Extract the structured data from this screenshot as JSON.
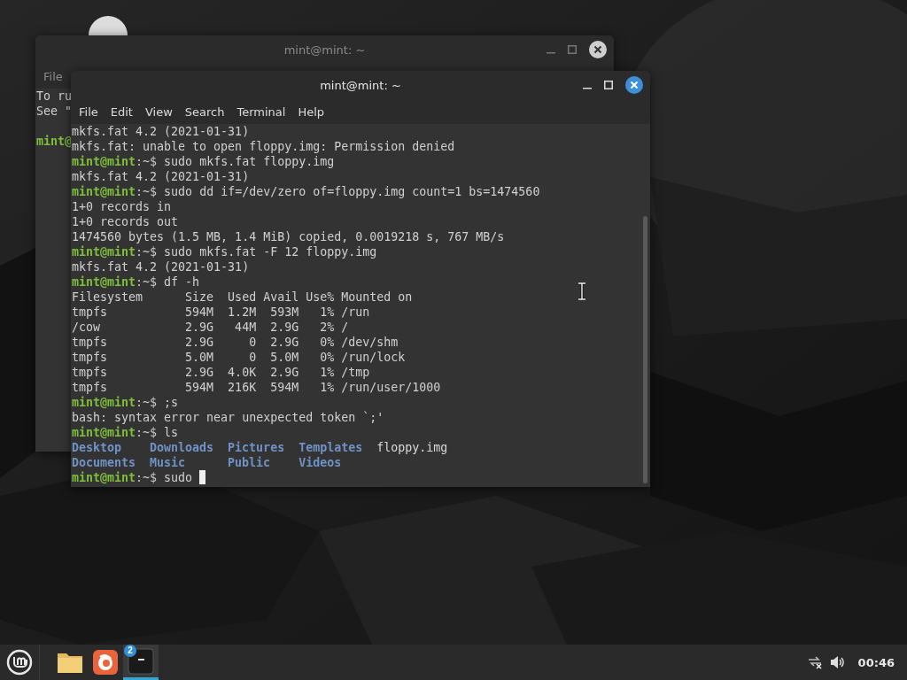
{
  "back_window": {
    "title": "mint@mint: ~",
    "focused": false,
    "menu": [
      "File"
    ],
    "lines": [
      {
        "kind": "output",
        "text": "To ru"
      },
      {
        "kind": "output",
        "text": "See \""
      },
      {
        "kind": "blank"
      },
      {
        "kind": "prompt",
        "host": "mint@"
      }
    ]
  },
  "front_window": {
    "title": "mint@mint: ~",
    "focused": true,
    "menu": [
      "File",
      "Edit",
      "View",
      "Search",
      "Terminal",
      "Help"
    ],
    "lines": [
      {
        "kind": "output",
        "text": "mkfs.fat 4.2 (2021-01-31)"
      },
      {
        "kind": "output",
        "text": "mkfs.fat: unable to open floppy.img: Permission denied"
      },
      {
        "kind": "prompt",
        "host": "mint@mint",
        "path": ":~$",
        "command": "sudo mkfs.fat floppy.img"
      },
      {
        "kind": "output",
        "text": "mkfs.fat 4.2 (2021-01-31)"
      },
      {
        "kind": "prompt",
        "host": "mint@mint",
        "path": ":~$",
        "command": "sudo dd if=/dev/zero of=floppy.img count=1 bs=1474560"
      },
      {
        "kind": "output",
        "text": "1+0 records in"
      },
      {
        "kind": "output",
        "text": "1+0 records out"
      },
      {
        "kind": "output",
        "text": "1474560 bytes (1.5 MB, 1.4 MiB) copied, 0.0019218 s, 767 MB/s"
      },
      {
        "kind": "prompt",
        "host": "mint@mint",
        "path": ":~$",
        "command": "sudo mkfs.fat -F 12 floppy.img"
      },
      {
        "kind": "output",
        "text": "mkfs.fat 4.2 (2021-01-31)"
      },
      {
        "kind": "prompt",
        "host": "mint@mint",
        "path": ":~$",
        "command": "df -h"
      },
      {
        "kind": "output",
        "text": "Filesystem      Size  Used Avail Use% Mounted on"
      },
      {
        "kind": "output",
        "text": "tmpfs           594M  1.2M  593M   1% /run"
      },
      {
        "kind": "output",
        "text": "/cow            2.9G   44M  2.9G   2% /"
      },
      {
        "kind": "output",
        "text": "tmpfs           2.9G     0  2.9G   0% /dev/shm"
      },
      {
        "kind": "output",
        "text": "tmpfs           5.0M     0  5.0M   0% /run/lock"
      },
      {
        "kind": "output",
        "text": "tmpfs           2.9G  4.0K  2.9G   1% /tmp"
      },
      {
        "kind": "output",
        "text": "tmpfs           594M  216K  594M   1% /run/user/1000"
      },
      {
        "kind": "prompt",
        "host": "mint@mint",
        "path": ":~$",
        "command": ";s"
      },
      {
        "kind": "output",
        "text": "bash: syntax error near unexpected token `;'"
      },
      {
        "kind": "prompt",
        "host": "mint@mint",
        "path": ":~$",
        "command": "ls"
      },
      {
        "kind": "listing",
        "entries": [
          {
            "text": "Desktop",
            "kind": "dir"
          },
          {
            "text": "Downloads",
            "kind": "dir"
          },
          {
            "text": "Pictures",
            "kind": "dir"
          },
          {
            "text": "Templates",
            "kind": "dir"
          },
          {
            "text": "floppy.img",
            "kind": "file"
          }
        ]
      },
      {
        "kind": "listing",
        "entries": [
          {
            "text": "Documents",
            "kind": "dir"
          },
          {
            "text": "Music",
            "kind": "dir"
          },
          {
            "text": "Public",
            "kind": "dir"
          },
          {
            "text": "Videos",
            "kind": "dir"
          }
        ]
      },
      {
        "kind": "prompt",
        "host": "mint@mint",
        "path": ":~$",
        "command": "sudo",
        "cursor": true
      }
    ]
  },
  "taskbar": {
    "launchers": [
      {
        "kind": "folder",
        "active": false
      },
      {
        "kind": "browser",
        "active": false
      },
      {
        "kind": "terminal",
        "active": true,
        "badge": "2"
      }
    ],
    "clock": "00:46"
  }
}
